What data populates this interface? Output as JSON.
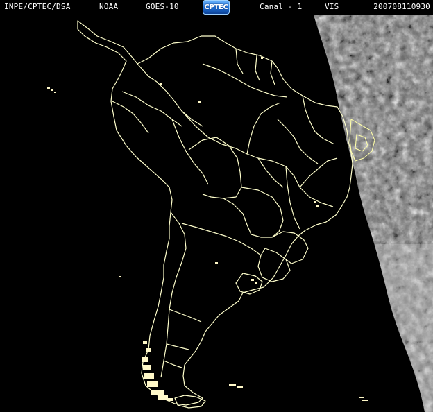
{
  "header": {
    "agency": "INPE/CPTEC/DSA",
    "noaa": "NOAA",
    "satellite": "GOES-10",
    "logo_text": "CPTEC",
    "channel": "Canal - 1",
    "band": "VIS",
    "datetime": "200708110930"
  },
  "colors": {
    "background": "#000000",
    "borders": "#ffffcc",
    "clouds": "#d8d8d8",
    "header_text": "#ffffff"
  }
}
